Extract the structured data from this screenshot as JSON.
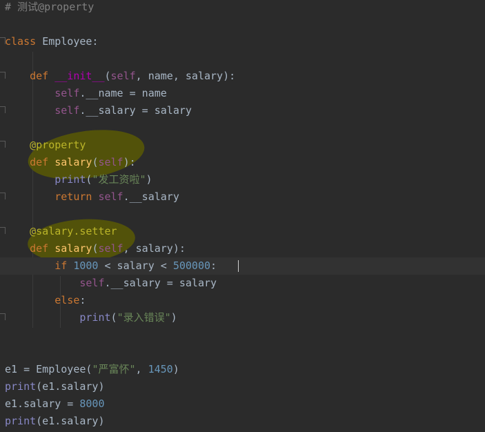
{
  "editor": {
    "lines": [
      {
        "tokens": [
          {
            "c": "cmt",
            "t": "# 测试@property"
          }
        ]
      },
      {
        "tokens": []
      },
      {
        "tokens": [
          {
            "c": "kw",
            "t": "class "
          },
          {
            "c": "plain",
            "t": "Employee:"
          }
        ]
      },
      {
        "tokens": []
      },
      {
        "tokens": [
          {
            "c": "plain",
            "t": "    "
          },
          {
            "c": "kw",
            "t": "def "
          },
          {
            "c": "dunder",
            "t": "__init__"
          },
          {
            "c": "plain",
            "t": "("
          },
          {
            "c": "self",
            "t": "self"
          },
          {
            "c": "plain",
            "t": ", name, salary):"
          }
        ]
      },
      {
        "tokens": [
          {
            "c": "plain",
            "t": "        "
          },
          {
            "c": "self",
            "t": "self"
          },
          {
            "c": "plain",
            "t": ".__name = name"
          }
        ]
      },
      {
        "tokens": [
          {
            "c": "plain",
            "t": "        "
          },
          {
            "c": "self",
            "t": "self"
          },
          {
            "c": "plain",
            "t": ".__salary = salary"
          }
        ]
      },
      {
        "tokens": []
      },
      {
        "tokens": [
          {
            "c": "plain",
            "t": "    "
          },
          {
            "c": "dec",
            "t": "@property"
          }
        ]
      },
      {
        "tokens": [
          {
            "c": "plain",
            "t": "    "
          },
          {
            "c": "kw",
            "t": "def "
          },
          {
            "c": "fn",
            "t": "salary"
          },
          {
            "c": "plain",
            "t": "("
          },
          {
            "c": "self",
            "t": "self"
          },
          {
            "c": "plain",
            "t": "):"
          }
        ]
      },
      {
        "tokens": [
          {
            "c": "plain",
            "t": "        "
          },
          {
            "c": "builtin",
            "t": "print"
          },
          {
            "c": "plain",
            "t": "("
          },
          {
            "c": "str",
            "t": "\"发工资啦\""
          },
          {
            "c": "plain",
            "t": ")"
          }
        ]
      },
      {
        "tokens": [
          {
            "c": "plain",
            "t": "        "
          },
          {
            "c": "kw",
            "t": "return "
          },
          {
            "c": "self",
            "t": "self"
          },
          {
            "c": "plain",
            "t": ".__salary"
          }
        ]
      },
      {
        "tokens": []
      },
      {
        "tokens": [
          {
            "c": "plain",
            "t": "    "
          },
          {
            "c": "dec",
            "t": "@salary.setter"
          }
        ]
      },
      {
        "tokens": [
          {
            "c": "plain",
            "t": "    "
          },
          {
            "c": "kw",
            "t": "def "
          },
          {
            "c": "fn",
            "t": "salary"
          },
          {
            "c": "plain",
            "t": "("
          },
          {
            "c": "self",
            "t": "self"
          },
          {
            "c": "plain",
            "t": ", salary):"
          }
        ]
      },
      {
        "tokens": [
          {
            "c": "plain",
            "t": "        "
          },
          {
            "c": "kw",
            "t": "if "
          },
          {
            "c": "num",
            "t": "1000"
          },
          {
            "c": "plain",
            "t": " < salary < "
          },
          {
            "c": "num",
            "t": "500000"
          },
          {
            "c": "plain",
            "t": ":"
          }
        ]
      },
      {
        "tokens": [
          {
            "c": "plain",
            "t": "            "
          },
          {
            "c": "self",
            "t": "self"
          },
          {
            "c": "plain",
            "t": ".__salary = salary"
          }
        ]
      },
      {
        "tokens": [
          {
            "c": "plain",
            "t": "        "
          },
          {
            "c": "kw",
            "t": "else"
          },
          {
            "c": "plain",
            "t": ":"
          }
        ]
      },
      {
        "tokens": [
          {
            "c": "plain",
            "t": "            "
          },
          {
            "c": "builtin",
            "t": "print"
          },
          {
            "c": "plain",
            "t": "("
          },
          {
            "c": "str",
            "t": "\"录入错误\""
          },
          {
            "c": "plain",
            "t": ")"
          }
        ]
      },
      {
        "tokens": []
      },
      {
        "tokens": []
      },
      {
        "tokens": [
          {
            "c": "plain",
            "t": "e1 = Employee("
          },
          {
            "c": "str",
            "t": "\"严富怀\""
          },
          {
            "c": "plain",
            "t": ", "
          },
          {
            "c": "num",
            "t": "1450"
          },
          {
            "c": "plain",
            "t": ")"
          }
        ]
      },
      {
        "tokens": [
          {
            "c": "builtin",
            "t": "print"
          },
          {
            "c": "plain",
            "t": "(e1.salary)"
          }
        ]
      },
      {
        "tokens": [
          {
            "c": "plain",
            "t": "e1.salary = "
          },
          {
            "c": "num",
            "t": "8000"
          }
        ]
      },
      {
        "tokens": [
          {
            "c": "builtin",
            "t": "print"
          },
          {
            "c": "plain",
            "t": "(e1.salary)"
          }
        ]
      }
    ],
    "current_line": 15
  },
  "colors": {
    "background": "#2b2b2b",
    "keyword": "#cc7832",
    "self": "#94558d",
    "dunder": "#b200b2",
    "decorator": "#bbb529",
    "number": "#6897bb",
    "string": "#6a8759",
    "comment": "#808080",
    "function": "#ffc66d",
    "builtin": "#8888c6",
    "text": "#a9b7c6",
    "highlight": "#606000"
  }
}
